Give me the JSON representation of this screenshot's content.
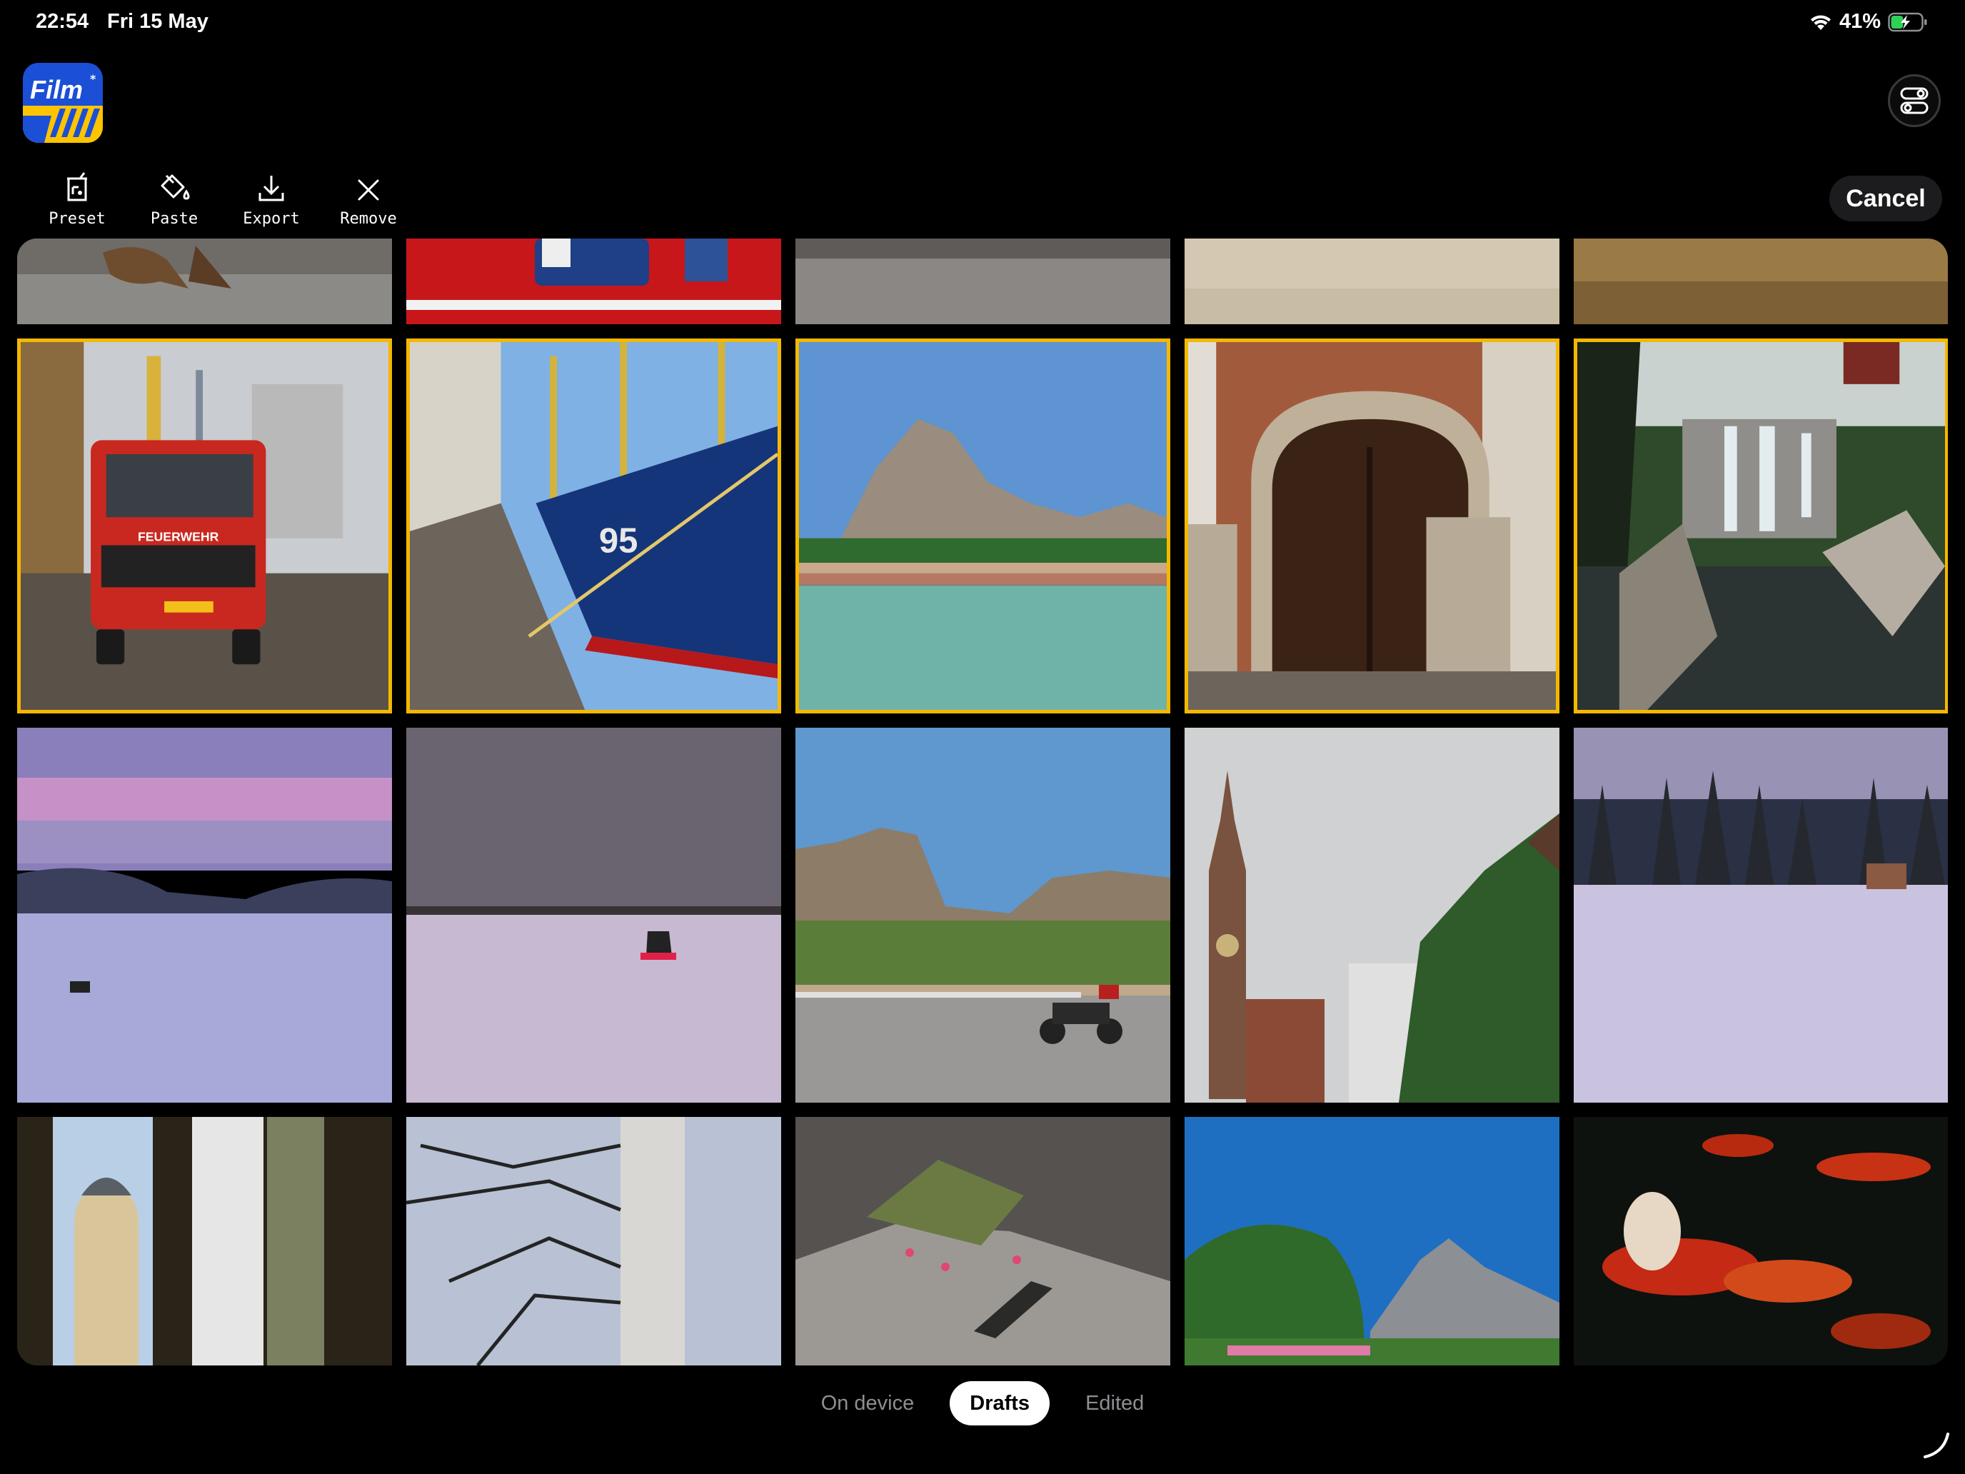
{
  "status_bar": {
    "time": "22:54",
    "date": "Fri 15 May",
    "battery_percent": "41%",
    "battery_level": 0.41,
    "charging": true
  },
  "app": {
    "logo_text": "Film",
    "logo_colors": {
      "blue": "#1a4fd6",
      "yellow": "#ffc400"
    }
  },
  "toolbar": {
    "items": [
      {
        "label": "Preset",
        "icon": "preset-icon"
      },
      {
        "label": "Paste",
        "icon": "paint-bucket-icon"
      },
      {
        "label": "Export",
        "icon": "download-icon"
      },
      {
        "label": "Remove",
        "icon": "close-icon"
      }
    ],
    "cancel_label": "Cancel",
    "toggle_icon": "toggles-icon"
  },
  "grid": {
    "selection_color": "#f5b800",
    "rows": [
      {
        "partial": true,
        "photos": [
          {
            "subject": "bird-on-rock",
            "selected": false
          },
          {
            "subject": "red-boat-hull",
            "selected": false
          },
          {
            "subject": "granite-stone",
            "selected": false
          },
          {
            "subject": "sand",
            "selected": false
          },
          {
            "subject": "dry-grass",
            "selected": false
          }
        ]
      },
      {
        "partial": false,
        "photos": [
          {
            "subject": "red-fire-truck-harbour",
            "selected": true,
            "text": "FEUERWEHR"
          },
          {
            "subject": "blue-fishing-boat",
            "selected": true,
            "text": "95"
          },
          {
            "subject": "beach-mountain",
            "selected": true
          },
          {
            "subject": "arched-wooden-door",
            "selected": true
          },
          {
            "subject": "japanese-garden-waterfall",
            "selected": true
          }
        ]
      },
      {
        "partial": false,
        "photos": [
          {
            "subject": "frozen-lake-purple-dusk",
            "selected": false
          },
          {
            "subject": "snowmobile-on-ice",
            "selected": false
          },
          {
            "subject": "scooter-mountain-road",
            "selected": false
          },
          {
            "subject": "gdansk-town-hall",
            "selected": false
          },
          {
            "subject": "snowy-pine-forest",
            "selected": false
          }
        ]
      },
      {
        "partial": true,
        "photos": [
          {
            "subject": "dome-through-window",
            "selected": false
          },
          {
            "subject": "frosted-birch-tree",
            "selected": false
          },
          {
            "subject": "lizard-on-rock",
            "selected": false
          },
          {
            "subject": "pine-tree-mountain",
            "selected": false
          },
          {
            "subject": "koi-fish",
            "selected": false
          }
        ]
      }
    ]
  },
  "segments": {
    "options": [
      "On device",
      "Drafts",
      "Edited"
    ],
    "active": "Drafts"
  }
}
